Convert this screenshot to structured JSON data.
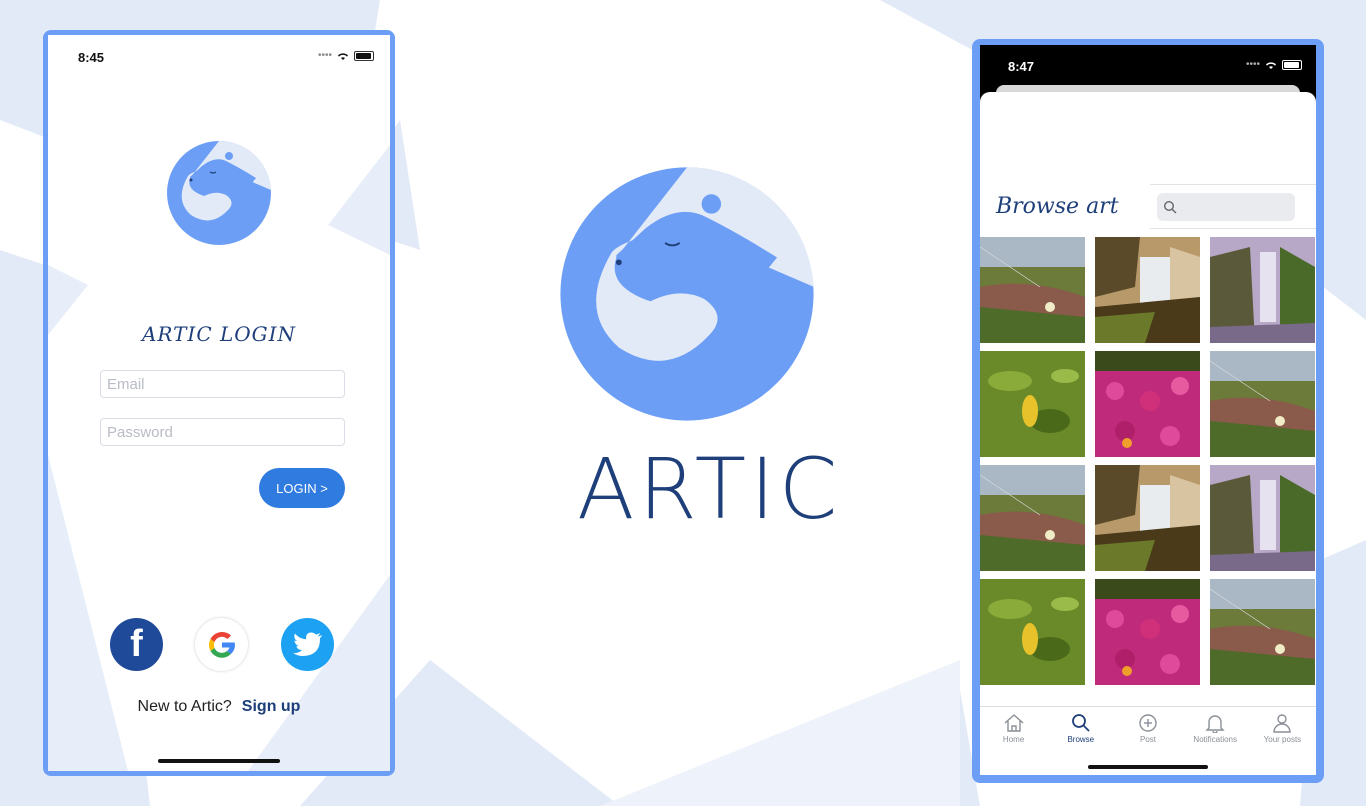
{
  "login_screen": {
    "status_time": "8:45",
    "title": "ARTIC LOGIN",
    "email_placeholder": "Email",
    "password_placeholder": "Password",
    "login_label": "LOGIN >",
    "social_buttons": [
      "facebook-icon",
      "google-icon",
      "twitter-icon"
    ],
    "facebook_glyph": "f",
    "new_user_text": "New to Artic?",
    "signup_label": "Sign up"
  },
  "brand": {
    "name": "ARTIC"
  },
  "browse_screen": {
    "status_time": "8:47",
    "title": "Browse art",
    "search_placeholder": "",
    "tiles": [
      "meadow-flower",
      "waterfall-cliff",
      "purple-waterfall",
      "green-leaves",
      "pink-flowers",
      "meadow-flower",
      "meadow-flower",
      "waterfall-cliff",
      "purple-waterfall",
      "green-leaves",
      "pink-flowers",
      "meadow-flower"
    ],
    "tabs": [
      {
        "label": "Home",
        "icon": "home-icon"
      },
      {
        "label": "Browse",
        "icon": "search-icon",
        "active": true
      },
      {
        "label": "Post",
        "icon": "plus-circle-icon"
      },
      {
        "label": "Notifications",
        "icon": "bell-icon"
      },
      {
        "label": "Your posts",
        "icon": "person-icon"
      }
    ]
  },
  "colors": {
    "accent": "#6c9ef5",
    "brand_text": "#1e3f7a",
    "button": "#2f7be0",
    "background_shapes": "#e3eaf7"
  }
}
